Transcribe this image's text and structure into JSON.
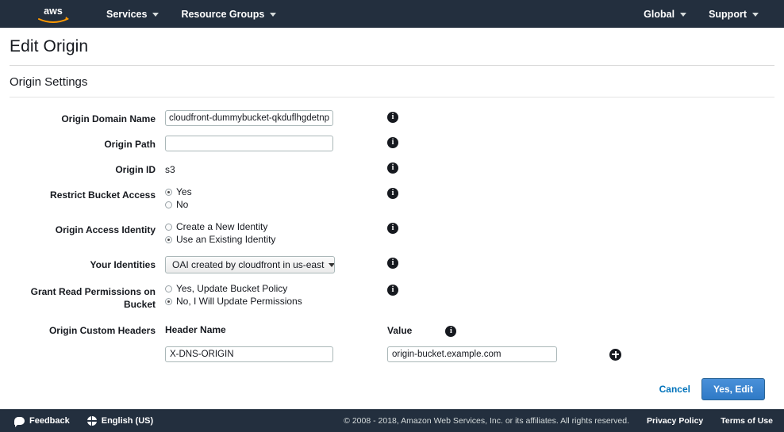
{
  "navbar": {
    "logo_alt": "aws",
    "items": [
      {
        "label": "Services"
      },
      {
        "label": "Resource Groups"
      }
    ],
    "right_items": [
      {
        "label": "Global"
      },
      {
        "label": "Support"
      }
    ]
  },
  "page": {
    "title": "Edit Origin",
    "section_title": "Origin Settings"
  },
  "form": {
    "origin_domain_name": {
      "label": "Origin Domain Name",
      "value": "cloudfront-dummybucket-qkduflhgdetnp",
      "placeholder": ""
    },
    "origin_path": {
      "label": "Origin Path",
      "value": "",
      "placeholder": ""
    },
    "origin_id": {
      "label": "Origin ID",
      "value": "s3"
    },
    "restrict_bucket_access": {
      "label": "Restrict Bucket Access",
      "options": [
        {
          "label": "Yes",
          "selected": true
        },
        {
          "label": "No",
          "selected": false
        }
      ]
    },
    "origin_access_identity": {
      "label": "Origin Access Identity",
      "options": [
        {
          "label": "Create a New Identity",
          "selected": false
        },
        {
          "label": "Use an Existing Identity",
          "selected": true
        }
      ]
    },
    "your_identities": {
      "label": "Your Identities",
      "selected": "OAI created by cloudfront in us-east"
    },
    "grant_read_permissions": {
      "label_line1": "Grant Read Permissions on",
      "label_line2": "Bucket",
      "options": [
        {
          "label": "Yes, Update Bucket Policy",
          "selected": false
        },
        {
          "label": "No, I Will Update Permissions",
          "selected": true
        }
      ]
    },
    "origin_custom_headers": {
      "label": "Origin Custom Headers",
      "header_name_column": "Header Name",
      "value_column": "Value",
      "rows": [
        {
          "name": "X-DNS-ORIGIN",
          "value": "origin-bucket.example.com"
        }
      ]
    }
  },
  "actions": {
    "cancel_label": "Cancel",
    "submit_label": "Yes, Edit"
  },
  "footer": {
    "feedback_label": "Feedback",
    "language_label": "English (US)",
    "copyright": "© 2008 - 2018, Amazon Web Services, Inc. or its affiliates. All rights reserved.",
    "privacy_label": "Privacy Policy",
    "terms_label": "Terms of Use"
  },
  "colors": {
    "navbar_bg": "#232f3e",
    "primary_button": "#3a87d6",
    "link": "#0073bb",
    "page_bg": "#ffffff"
  }
}
